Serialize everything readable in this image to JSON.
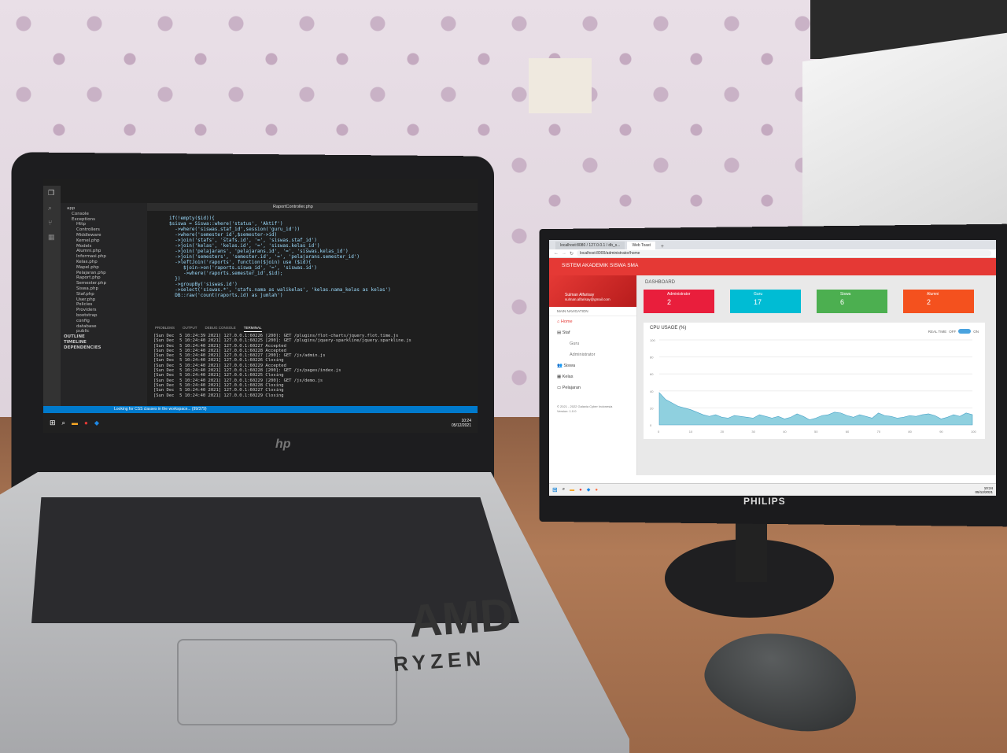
{
  "laptop": {
    "brand_logo": "hp",
    "sticker_primary": "AMD",
    "sticker_secondary": "RYZEN",
    "vscode": {
      "active_tab": "RaportController.php",
      "explorer_items": [
        "app",
        "Console",
        "Exceptions",
        "Http",
        "Controllers",
        "Middleware",
        "Kernel.php",
        "Models",
        "Alumni.php",
        "Informasi.php",
        "Kelas.php",
        "Mapel.php",
        "Pelajaran.php",
        "Raport.php",
        "Semester.php",
        "Siswa.php",
        "Staf.php",
        "User.php",
        "Policies",
        "Providers",
        "bootstrap",
        "config",
        "database",
        "public"
      ],
      "code_lines": [
        "if(!empty($id)){",
        "$siswa = Siswa::where('status', 'Aktif')",
        "  ->where('siswas.staf_id',session('guru_id'))",
        "  ->where('semester_id',$semester->id)",
        "  ->join('stafs', 'stafs.id', '=', 'siswas.staf_id')",
        "  ->join('kelas', 'kelas.id', '=', 'siswas.kelas_id')",
        "  ->join('pelajarans', 'pelajarans.id', '=', 'siswas.kelas_id')",
        "  ->join('semesters', 'semester.id', '=', 'pelajarans.semester_id')",
        "  ->leftJoin('raports', function($join) use ($id){",
        "     $join->on('raports.siswa_id', '=', 'siswas.id')",
        "     ->where('raports.semester_id',$id);",
        "  })",
        "  ->groupBy('siswas.id')",
        "  ->select('siswas.*', 'stafs.nama as walikelas', 'kelas.nama_kelas as kelas')",
        "  DB::raw('count(raports.id) as jumlah')"
      ],
      "panel_tabs": [
        "PROBLEMS",
        "OUTPUT",
        "DEBUG CONSOLE",
        "TERMINAL"
      ],
      "terminal_lines": [
        "[Sun Dec  5 10:24:39 2021] 127.0.0.1:60226 [200]: GET /plugins/flot-charts/jquery.flot.time.js",
        "[Sun Dec  5 10:24:40 2021] 127.0.0.1:60225 [200]: GET /plugins/jquery-sparkline/jquery.sparkline.js",
        "[Sun Dec  5 10:24:40 2021] 127.0.0.1:60227 Accepted",
        "[Sun Dec  5 10:24:40 2021] 127.0.0.1:60228 Accepted",
        "[Sun Dec  5 10:24:40 2021] 127.0.0.1:60227 [200]: GET /js/admin.js",
        "[Sun Dec  5 10:24:40 2021] 127.0.0.1:60226 Closing",
        "[Sun Dec  5 10:24:40 2021] 127.0.0.1:60229 Accepted",
        "[Sun Dec  5 10:24:40 2021] 127.0.0.1:60228 [200]: GET /js/pages/index.js",
        "[Sun Dec  5 10:24:40 2021] 127.0.0.1:60225 Closing",
        "[Sun Dec  5 10:24:40 2021] 127.0.0.1:60229 [200]: GET /js/demo.js",
        "[Sun Dec  5 10:24:40 2021] 127.0.0.1:60228 Closing",
        "[Sun Dec  5 10:24:40 2021] 127.0.0.1:60227 Closing",
        "[Sun Dec  5 10:24:40 2021] 127.0.0.1:60229 Closing"
      ],
      "status_bar": "Looking for CSS classes in the workspace... (99/379)",
      "sidebar_sections": [
        "OUTLINE",
        "TIMELINE",
        "DEPENDENCIES"
      ],
      "taskbar_time": "10:24",
      "taskbar_date": "05/12/2021"
    }
  },
  "monitor": {
    "brand": "PHILIPS",
    "browser": {
      "tabs": [
        "localhost:8080 / 127.0.0.1 / db_s...",
        "Web Toast"
      ],
      "url": "localhost:8000/administrator/home"
    },
    "app_title": "SISTEM AKADEMIK SISWA SMA",
    "user": {
      "name": "Sulman Alfarisay",
      "email": "sulman.alfarisay@gmail.com"
    },
    "main_navigation_label": "MAIN NAVIGATION",
    "nav_items": [
      "Home",
      "Staf",
      "Guru",
      "Administrator",
      "Siswa",
      "Kelas",
      "Pelajaran"
    ],
    "footer": "© 2021 - 2022 Galaxia Cyber Indonesia",
    "version": "Version: 1.0.0",
    "dashboard_title": "DASHBOARD",
    "cards": [
      {
        "label": "Administrator",
        "value": "2",
        "color": "#e91e3c"
      },
      {
        "label": "Guru",
        "value": "17",
        "color": "#00bcd4"
      },
      {
        "label": "Siswa",
        "value": "6",
        "color": "#4caf50"
      },
      {
        "label": "Alumni",
        "value": "2",
        "color": "#f4511e"
      }
    ],
    "cpu": {
      "title": "CPU USAGE (%)",
      "realtime_label": "REAL TIME",
      "off_label": "OFF",
      "on_label": "ON"
    },
    "taskbar_time": "10:24",
    "taskbar_date": "05/12/2021"
  },
  "chart_data": {
    "type": "area",
    "title": "CPU USAGE (%)",
    "xlabel": "",
    "ylabel": "",
    "x_ticks": [
      0,
      10,
      20,
      30,
      40,
      50,
      60,
      70,
      80,
      90,
      100
    ],
    "y_ticks": [
      0,
      20,
      40,
      60,
      80,
      100
    ],
    "ylim": [
      0,
      100
    ],
    "xlim": [
      0,
      100
    ],
    "x": [
      0,
      2,
      4,
      6,
      8,
      10,
      12,
      14,
      16,
      18,
      20,
      22,
      24,
      26,
      28,
      30,
      32,
      34,
      36,
      38,
      40,
      42,
      44,
      46,
      48,
      50,
      52,
      54,
      56,
      58,
      60,
      62,
      64,
      66,
      68,
      70,
      72,
      74,
      76,
      78,
      80,
      82,
      84,
      86,
      88,
      90,
      92,
      94,
      96,
      98,
      100
    ],
    "values": [
      38,
      30,
      26,
      22,
      20,
      18,
      15,
      12,
      10,
      12,
      9,
      8,
      11,
      10,
      9,
      8,
      12,
      10,
      8,
      10,
      7,
      9,
      13,
      10,
      6,
      8,
      11,
      12,
      15,
      14,
      11,
      9,
      12,
      10,
      8,
      14,
      11,
      10,
      8,
      9,
      11,
      10,
      12,
      13,
      11,
      7,
      9,
      12,
      10,
      14,
      12
    ],
    "fill_color": "#8fd0df"
  }
}
